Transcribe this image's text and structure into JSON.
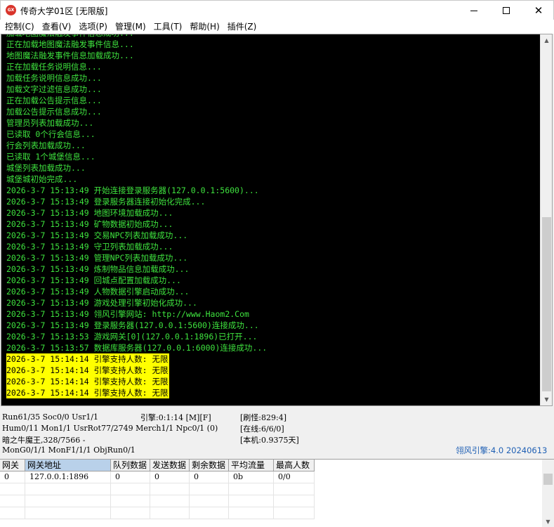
{
  "window": {
    "title": "传奇大学01区 [无限版]",
    "icon_text": "GX",
    "controls": {
      "minimize": "minimize-icon",
      "maximize": "maximize-icon",
      "close": "close-icon"
    }
  },
  "menu": [
    "控制(C)",
    "查看(V)",
    "选项(P)",
    "管理(M)",
    "工具(T)",
    "帮助(H)",
    "插件(Z)"
  ],
  "console": {
    "text_color": "#3ee23e",
    "highlight_color": "#ffff00",
    "lines": [
      "加载地图魔法融发事件信息成功...",
      "正在加载地图魔法融发事件信息...",
      "地图魔法融发事件信息加载成功...",
      "正在加载任务说明信息...",
      "加载任务说明信息成功...",
      "加载文字过滤信息成功...",
      "正在加载公告提示信息...",
      "加载公告提示信息成功...",
      "管理员列表加载成功...",
      "已读取 0个行会信息...",
      "行会列表加载成功...",
      "已读取 1个城堡信息...",
      "城堡列表加载成功...",
      "城堡城初始完成...",
      "2026-3-7 15:13:49 开始连接登录服务器(127.0.0.1:5600)...",
      "2026-3-7 15:13:49 登录服务器连接初始化完成...",
      "2026-3-7 15:13:49 地图环境加载成功...",
      "2026-3-7 15:13:49 矿物数据初始成功...",
      "2026-3-7 15:13:49 交易NPC列表加载成功...",
      "2026-3-7 15:13:49 守卫列表加载成功...",
      "2026-3-7 15:13:49 管理NPC列表加载成功...",
      "2026-3-7 15:13:49 炼制物品信息加载成功...",
      "2026-3-7 15:13:49 回城点配置加载成功...",
      "2026-3-7 15:13:49 人物数据引擎启动成功...",
      "2026-3-7 15:13:49 游戏处理引擎初始化成功...",
      "2026-3-7 15:13:49 翎风引擎网站: http://www.Haom2.Com",
      "2026-3-7 15:13:49 登录服务器(127.0.0.1:5600)连接成功...",
      "2026-3-7 15:13:53 游戏网关[0](127.0.0.1:1896)已打开...",
      "2026-3-7 15:13:57 数据库服务器(127.0.0.1:6000)连接成功..."
    ],
    "highlighted_lines": [
      "2026-3-7 15:14:14 引擎支持人数: 无限",
      "2026-3-7 15:14:14 引擎支持人数: 无限",
      "2026-3-7 15:14:14 引擎支持人数: 无限",
      "2026-3-7 15:14:14 引擎支持人数: 无限"
    ]
  },
  "status": {
    "row1_left": "Run61/35 Soc0/0 Usr1/1",
    "row1_engine": "引擎:0:1:14 [M][F]",
    "row1_right": "[刷怪:829:4]",
    "row2_left": "Hum0/11 Mon1/1 UsrRot77/2749 Merch1/1 Npc0/1 (0)",
    "row2_right": "[在线:6/6/0]",
    "row3_left": "暗之牛魔王,328/7566 -",
    "row3_right": "[本机:0.9375天]",
    "row4_left": "MonG0/1/1 MonF1/1/1 ObjRun0/1",
    "version": "翎风引擎:4.0 20240613"
  },
  "grid": {
    "headers": [
      "网关",
      "网关地址",
      "队列数据",
      "发送数据",
      "剩余数据",
      "平均流量",
      "最高人数"
    ],
    "rows": [
      [
        "0",
        "127.0.0.1:1896",
        "0",
        "0",
        "0",
        "0b",
        "0/0"
      ]
    ]
  }
}
